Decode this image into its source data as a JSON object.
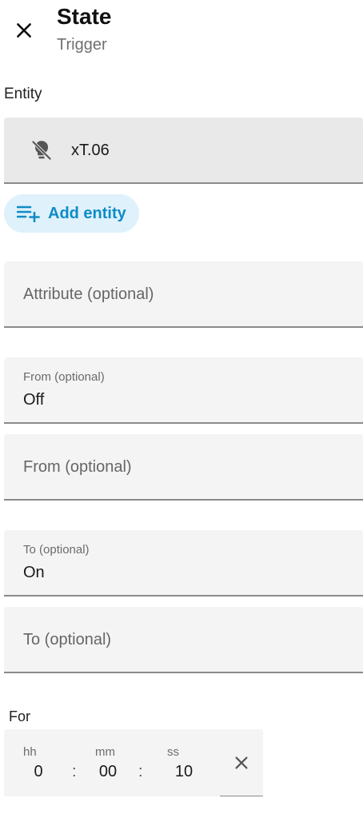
{
  "header": {
    "title": "State",
    "subtitle": "Trigger"
  },
  "entity_section": {
    "label": "Entity",
    "entity_value": "xT.06",
    "entity_icon": "lightbulb-off-icon",
    "add_entity_label": "Add entity"
  },
  "fields": {
    "attribute_placeholder": "Attribute (optional)",
    "from_label": "From (optional)",
    "from_value": "Off",
    "from_placeholder": "From (optional)",
    "to_label": "To (optional)",
    "to_value": "On",
    "to_placeholder": "To (optional)"
  },
  "duration": {
    "label": "For",
    "hours_label": "hh",
    "hours_value": "0",
    "minutes_label": "mm",
    "minutes_value": "00",
    "seconds_label": "ss",
    "seconds_value": "10",
    "separator": ":"
  },
  "colors": {
    "accent": "#0d8cc7",
    "chip_background": "#dff1fb",
    "field_background": "#f4f4f4",
    "entity_background": "#e9e9e9"
  }
}
